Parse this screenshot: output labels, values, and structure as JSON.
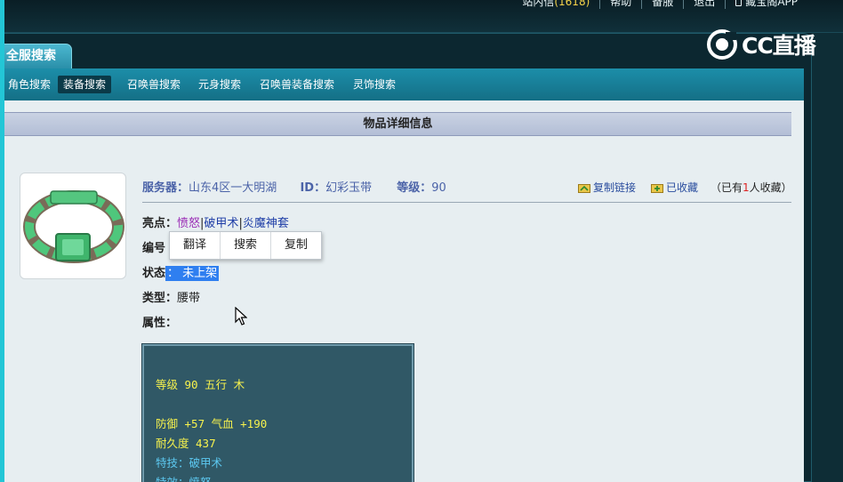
{
  "top_nav": {
    "message_label": "站内信",
    "message_count": "(1618)",
    "help": "帮助",
    "backup": "备服",
    "logout": "退出",
    "app": "藏宝阁APP"
  },
  "logo_text": "CC直播",
  "main_tab": "全服搜索",
  "sub_nav": [
    "角色搜索",
    "装备搜索",
    "召唤兽搜索",
    "元身搜索",
    "召唤兽装备搜索",
    "灵饰搜索"
  ],
  "active_sub_nav": "装备搜索",
  "section_title": "物品详细信息",
  "item": {
    "server_label": "服务器：",
    "server_value": "山东4区一大明湖",
    "id_label": "ID：",
    "id_value": "幻彩玉带",
    "level_label": "等级：",
    "level_value": "90",
    "copy_link": "复制链接",
    "favorited": "已收藏",
    "fav_prefix": "（已有",
    "fav_count": "1",
    "fav_suffix": "人收藏）",
    "highlights_label": "亮点：",
    "highlights": [
      "愤怒",
      "破甲术",
      "炎魔神套"
    ],
    "number_label": "编号",
    "status_label": "状态",
    "status_value": "：  未上架",
    "type_label": "类型：",
    "type_value": "腰带",
    "attr_label": "属性："
  },
  "context_menu": [
    "翻译",
    "搜索",
    "复制"
  ],
  "stats": {
    "line1": "等级 90  五行 木",
    "line2": "防御 +57 气血 +190",
    "line3": "耐久度 437",
    "line4": "特技：破甲术",
    "line5": "特效：愤怒"
  },
  "colors": {
    "accent_cyan": "#23c6d6",
    "nav_blue": "#1c8ea9",
    "stat_yellow": "#f7f24d",
    "stat_cyan": "#5cc8f0",
    "highlight_purple": "#9b2fb6"
  }
}
